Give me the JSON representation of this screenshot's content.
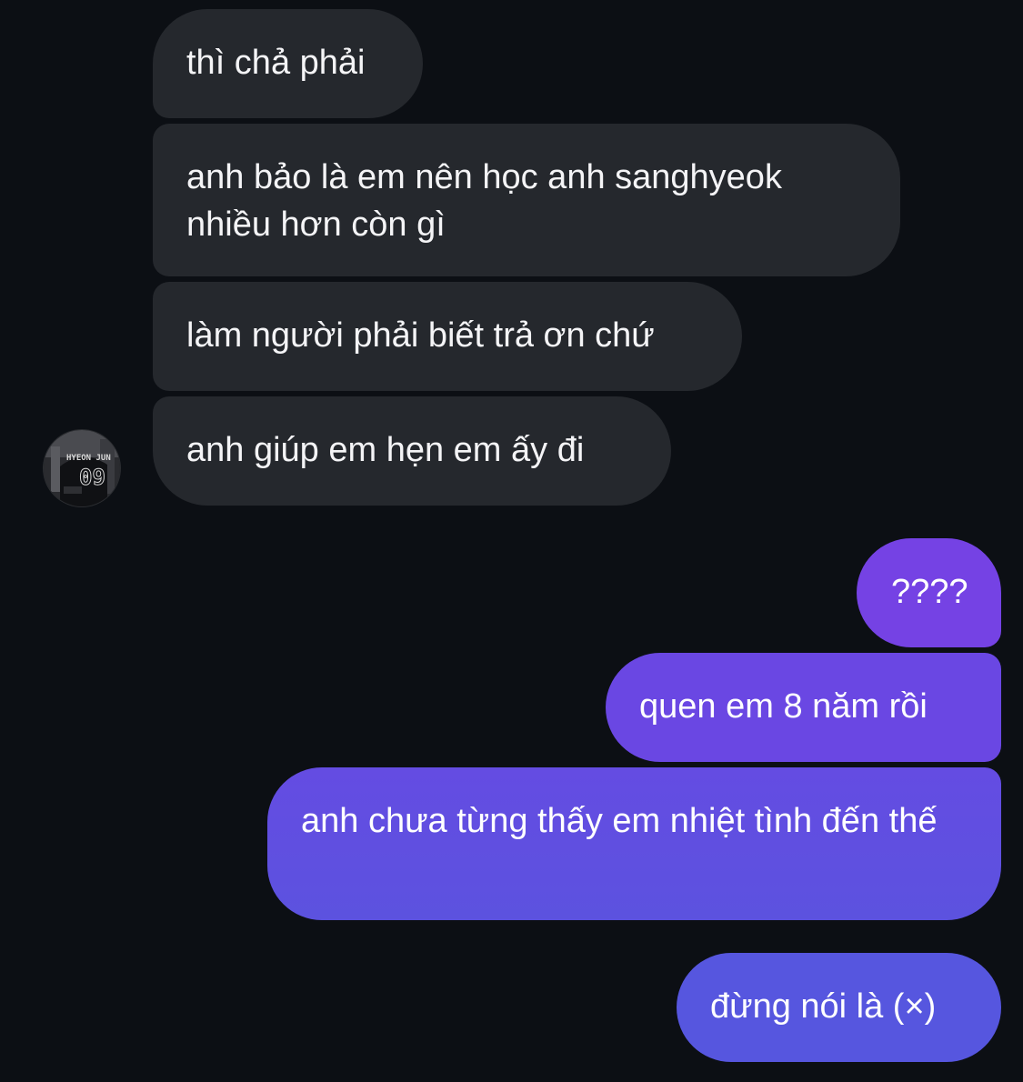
{
  "conversation": {
    "incoming": [
      {
        "text": "thì chả phải"
      },
      {
        "text": "anh bảo là em nên học anh sanghyeok nhiều hơn còn gì"
      },
      {
        "text": "làm người phải biết trả ơn chứ"
      },
      {
        "text": "anh giúp em hẹn em ấy đi"
      }
    ],
    "outgoing": [
      {
        "text": "????"
      },
      {
        "text": "quen em 8 năm rồi"
      },
      {
        "text": "anh chưa từng thấy em nhiệt tình đến thế"
      },
      {
        "text": "đừng nói là (×)"
      }
    ]
  },
  "avatar": {
    "jersey_name": "HYEON JUN",
    "jersey_number": "09"
  },
  "colors": {
    "background": "#0c0f14",
    "incoming_bubble": "#25282d",
    "outgoing_bubble_top": "#7542e4",
    "outgoing_bubble_bottom": "#5656df"
  }
}
